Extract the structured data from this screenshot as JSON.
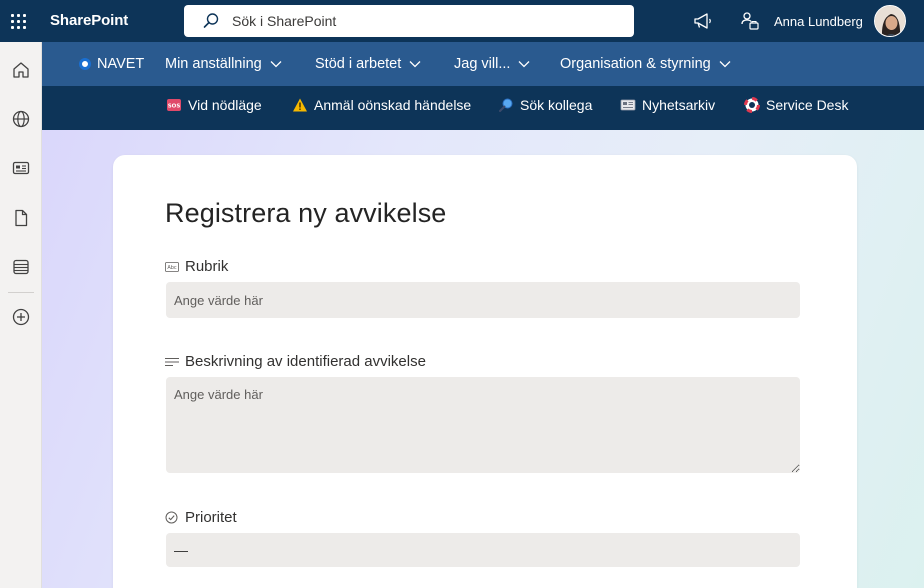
{
  "suite": {
    "brand": "SharePoint",
    "search_placeholder": "Sök i SharePoint",
    "user_name": "Anna Lundberg"
  },
  "hub_nav": {
    "site_name": "NAVET",
    "items": [
      {
        "label": "Min anställning"
      },
      {
        "label": "Stöd i arbetet"
      },
      {
        "label": "Jag vill..."
      },
      {
        "label": "Organisation & styrning"
      }
    ]
  },
  "quick_links": [
    {
      "label": "Vid nödläge",
      "icon": "sos-icon"
    },
    {
      "label": "Anmäl oönskad händelse",
      "icon": "warning-icon"
    },
    {
      "label": "Sök kollega",
      "icon": "magnifier-icon"
    },
    {
      "label": "Nyhetsarkiv",
      "icon": "newspaper-icon"
    },
    {
      "label": "Service Desk",
      "icon": "lifebuoy-icon"
    }
  ],
  "form": {
    "title": "Registrera ny avvikelse",
    "fields": [
      {
        "label": "Rubrik",
        "placeholder": "Ange värde här",
        "icon": "text-field-icon"
      },
      {
        "label": "Beskrivning av identifierad avvikelse",
        "placeholder": "Ange värde här",
        "icon": "multiline-text-icon"
      },
      {
        "label": "Prioritet",
        "value": "—",
        "icon": "choice-check-icon"
      }
    ]
  },
  "colors": {
    "suite_bar": "#0d3458",
    "hub_nav": "#2a5a8f",
    "quick_links_bar": "#0d3458",
    "input_bg": "#edebe9"
  }
}
